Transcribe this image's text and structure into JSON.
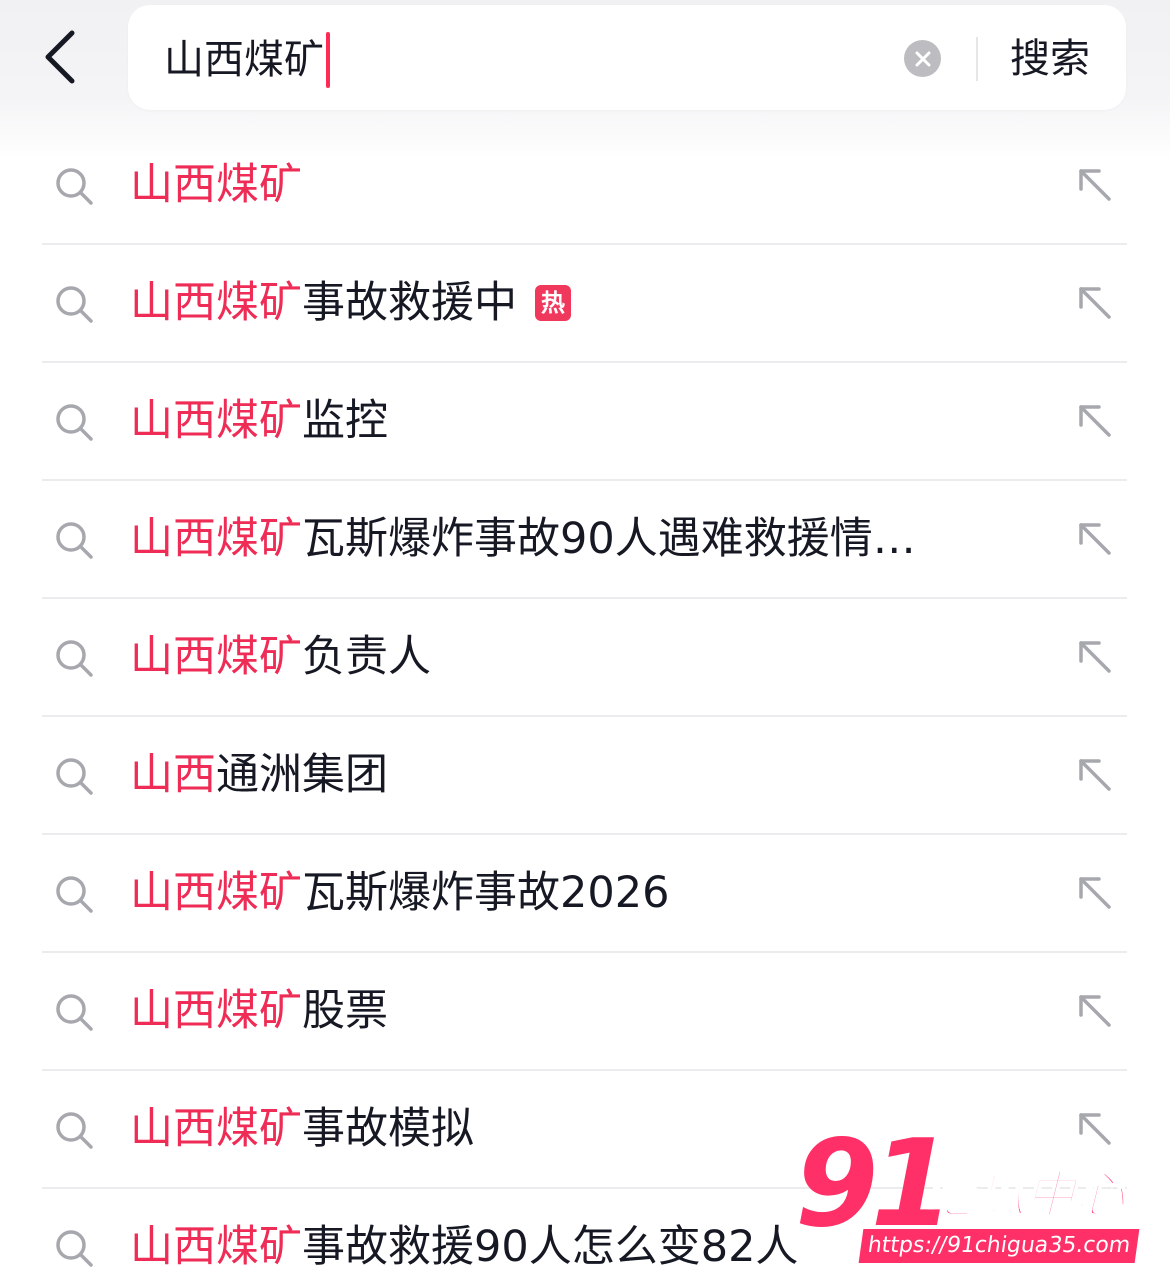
{
  "search": {
    "query": "山西煤矿",
    "submit_label": "搜索"
  },
  "suggestions": [
    {
      "highlight": "山西煤矿",
      "rest": "",
      "badge": ""
    },
    {
      "highlight": "山西煤矿",
      "rest": "事故救援中",
      "badge": "热"
    },
    {
      "highlight": "山西煤矿",
      "rest": "监控",
      "badge": ""
    },
    {
      "highlight": "山西煤矿",
      "rest": "瓦斯爆炸事故90人遇难救援情…",
      "badge": ""
    },
    {
      "highlight": "山西煤矿",
      "rest": "负责人",
      "badge": ""
    },
    {
      "highlight": "山西",
      "rest": "通洲集团",
      "badge": ""
    },
    {
      "highlight": "山西煤矿",
      "rest": "瓦斯爆炸事故2026",
      "badge": ""
    },
    {
      "highlight": "山西煤矿",
      "rest": "股票",
      "badge": ""
    },
    {
      "highlight": "山西煤矿",
      "rest": "事故模拟",
      "badge": ""
    },
    {
      "highlight": "山西煤矿",
      "rest": "事故救援90人怎么变82人",
      "badge": ""
    }
  ],
  "watermark": {
    "number": "91",
    "name": "吃瓜中心",
    "url": "https://91chigua35.com"
  },
  "icons": {
    "back": "chevron-left-icon",
    "clear": "clear-circle-icon",
    "suggestion": "search-icon",
    "fill": "arrow-up-left-icon"
  },
  "colors": {
    "highlight": "#ee2c55",
    "caret": "#fe2c55",
    "hot_badge": "#f0375c",
    "text": "#161823"
  }
}
